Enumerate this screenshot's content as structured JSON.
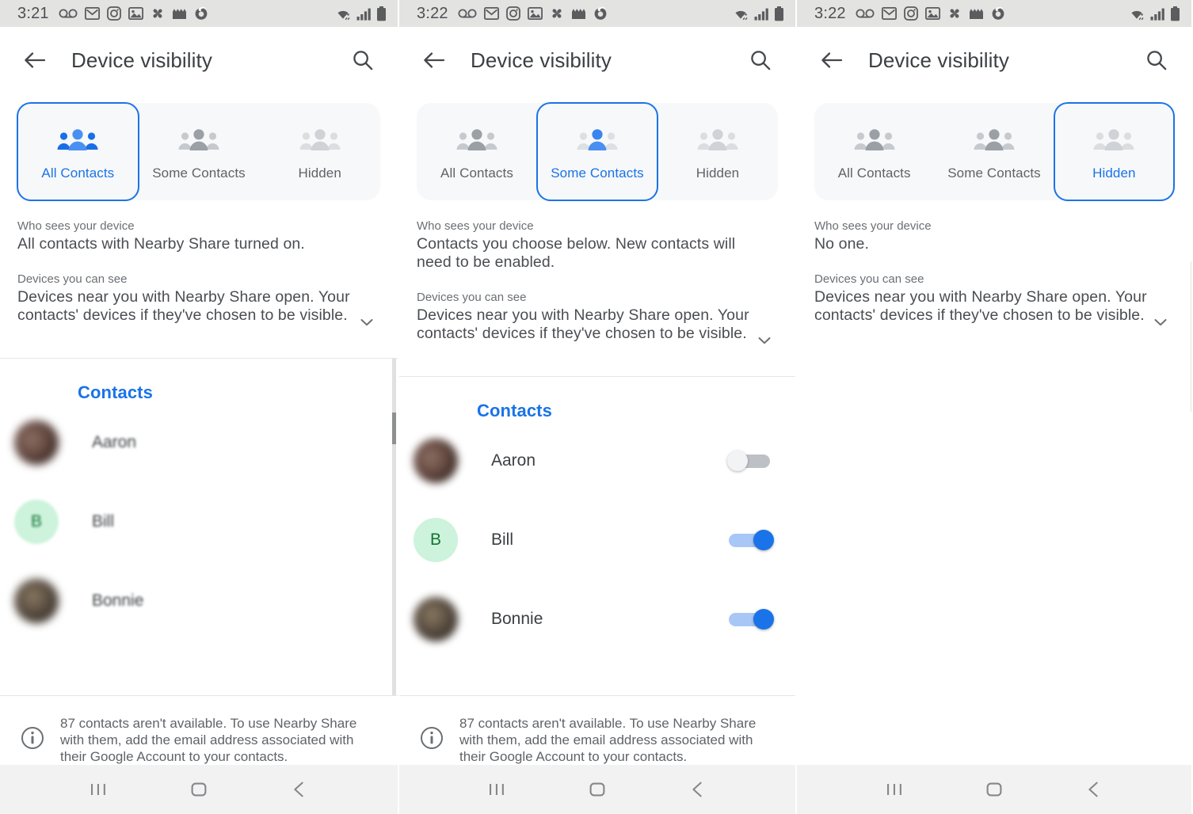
{
  "panels": [
    {
      "status": {
        "time": "3:21",
        "icons": [
          "voicemail-icon",
          "gmail-icon",
          "instagram-icon",
          "photos-icon",
          "pinwheel-icon",
          "clapper-icon",
          "firefox-icon"
        ],
        "right_icons": [
          "wifi-icon",
          "signal-icon",
          "battery-icon"
        ]
      },
      "appbar": {
        "back": "back-arrow-icon",
        "title": "Device visibility",
        "search": "search-icon"
      },
      "segments": [
        {
          "label": "All Contacts",
          "selected": true,
          "icon": "people-group-icon"
        },
        {
          "label": "Some Contacts",
          "selected": false,
          "icon": "people-group-icon"
        },
        {
          "label": "Hidden",
          "selected": false,
          "icon": "people-group-icon"
        }
      ],
      "description": [
        {
          "head": "Who sees your device",
          "body": "All contacts with Nearby Share turned on."
        },
        {
          "head": "Devices you can see",
          "body": "Devices near you with Nearby Share open. Your contacts' devices if they've chosen to be visible."
        }
      ],
      "contacts_header": "Contacts",
      "contacts": [
        {
          "name": "Aaron",
          "avatar": "photo",
          "toggle": null
        },
        {
          "name": "Bill",
          "avatar": "letter",
          "initial": "B",
          "toggle": null
        },
        {
          "name": "Bonnie",
          "avatar": "photo",
          "toggle": null
        }
      ],
      "footnote": "87 contacts aren't available. To use Nearby Share with them, add the email address associated with their Google Account to your contacts.",
      "show_contacts": true,
      "show_toggles": false,
      "blurred_list": true,
      "scrollbar": true,
      "nav": [
        "recents-icon",
        "home-icon",
        "back-icon"
      ]
    },
    {
      "status": {
        "time": "3:22",
        "icons": [
          "voicemail-icon",
          "gmail-icon",
          "instagram-icon",
          "photos-icon",
          "pinwheel-icon",
          "clapper-icon",
          "firefox-icon"
        ],
        "right_icons": [
          "wifi-icon",
          "signal-icon",
          "battery-icon"
        ]
      },
      "appbar": {
        "back": "back-arrow-icon",
        "title": "Device visibility",
        "search": "search-icon"
      },
      "segments": [
        {
          "label": "All Contacts",
          "selected": false,
          "icon": "people-group-icon"
        },
        {
          "label": "Some Contacts",
          "selected": true,
          "icon": "people-group-icon"
        },
        {
          "label": "Hidden",
          "selected": false,
          "icon": "people-group-icon"
        }
      ],
      "description": [
        {
          "head": "Who sees your device",
          "body": "Contacts you choose below. New contacts will need to be enabled."
        },
        {
          "head": "Devices you can see",
          "body": "Devices near you with Nearby Share open. Your contacts' devices if they've chosen to be visible."
        }
      ],
      "contacts_header": "Contacts",
      "contacts": [
        {
          "name": "Aaron",
          "avatar": "photo",
          "toggle": "off"
        },
        {
          "name": "Bill",
          "avatar": "letter",
          "initial": "B",
          "toggle": "on"
        },
        {
          "name": "Bonnie",
          "avatar": "photo",
          "toggle": "on"
        }
      ],
      "footnote": "87 contacts aren't available. To use Nearby Share with them, add the email address associated with their Google Account to your contacts.",
      "show_contacts": true,
      "show_toggles": true,
      "blurred_list": false,
      "scrollbar": false,
      "nav": [
        "recents-icon",
        "home-icon",
        "back-icon"
      ]
    },
    {
      "status": {
        "time": "3:22",
        "icons": [
          "voicemail-icon",
          "gmail-icon",
          "instagram-icon",
          "photos-icon",
          "pinwheel-icon",
          "clapper-icon",
          "firefox-icon"
        ],
        "right_icons": [
          "wifi-icon",
          "signal-icon",
          "battery-icon"
        ]
      },
      "appbar": {
        "back": "back-arrow-icon",
        "title": "Device visibility",
        "search": "search-icon"
      },
      "segments": [
        {
          "label": "All Contacts",
          "selected": false,
          "icon": "people-group-icon"
        },
        {
          "label": "Some Contacts",
          "selected": false,
          "icon": "people-group-icon"
        },
        {
          "label": "Hidden",
          "selected": true,
          "icon": "people-group-icon"
        }
      ],
      "description": [
        {
          "head": "Who sees your device",
          "body": "No one."
        },
        {
          "head": "Devices you can see",
          "body": "Devices near you with Nearby Share open. Your contacts' devices if they've chosen to be visible."
        }
      ],
      "contacts_header": "",
      "contacts": [],
      "footnote": "",
      "show_contacts": false,
      "show_toggles": false,
      "blurred_list": false,
      "scrollbar": false,
      "nav": [
        "recents-icon",
        "home-icon",
        "back-icon"
      ]
    }
  ],
  "colors": {
    "accent": "#1a73e8",
    "statusbar_bg": "#e3e3e2",
    "navbar_bg": "#f2f2f2",
    "seg_bg": "#f7f8f9",
    "toggle_on_track": "#a8c7f7",
    "toggle_off_track": "#bdc1c6",
    "letter_avatar_bg": "#cdf3dc",
    "letter_avatar_fg": "#137333"
  }
}
